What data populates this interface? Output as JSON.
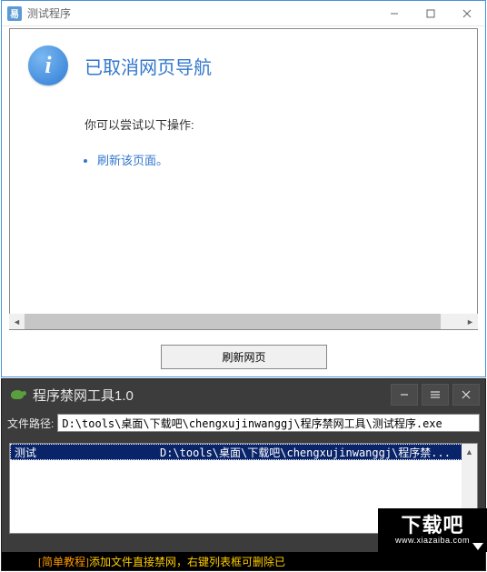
{
  "top": {
    "icon_text": "易",
    "title": "测试程序",
    "error": {
      "heading": "已取消网页导航",
      "subtext": "你可以尝试以下操作:",
      "link": "刷新该页面。"
    },
    "refresh_button": "刷新网页"
  },
  "bottom": {
    "title": "程序禁网工具1.0",
    "path_label": "文件路径:",
    "path_value": "D:\\tools\\桌面\\下载吧\\chengxujinwanggj\\程序禁网工具\\测试程序.exe",
    "list_item": {
      "name": "测试",
      "path": "D:\\tools\\桌面\\下载吧\\chengxujinwanggj\\程序禁..."
    },
    "status": {
      "bracket": "[简单教程]",
      "text": "添加文件直接禁网，右键列表框可删除已"
    }
  },
  "watermark": {
    "big": "下载吧",
    "small": "www.xiazaiba.com"
  }
}
